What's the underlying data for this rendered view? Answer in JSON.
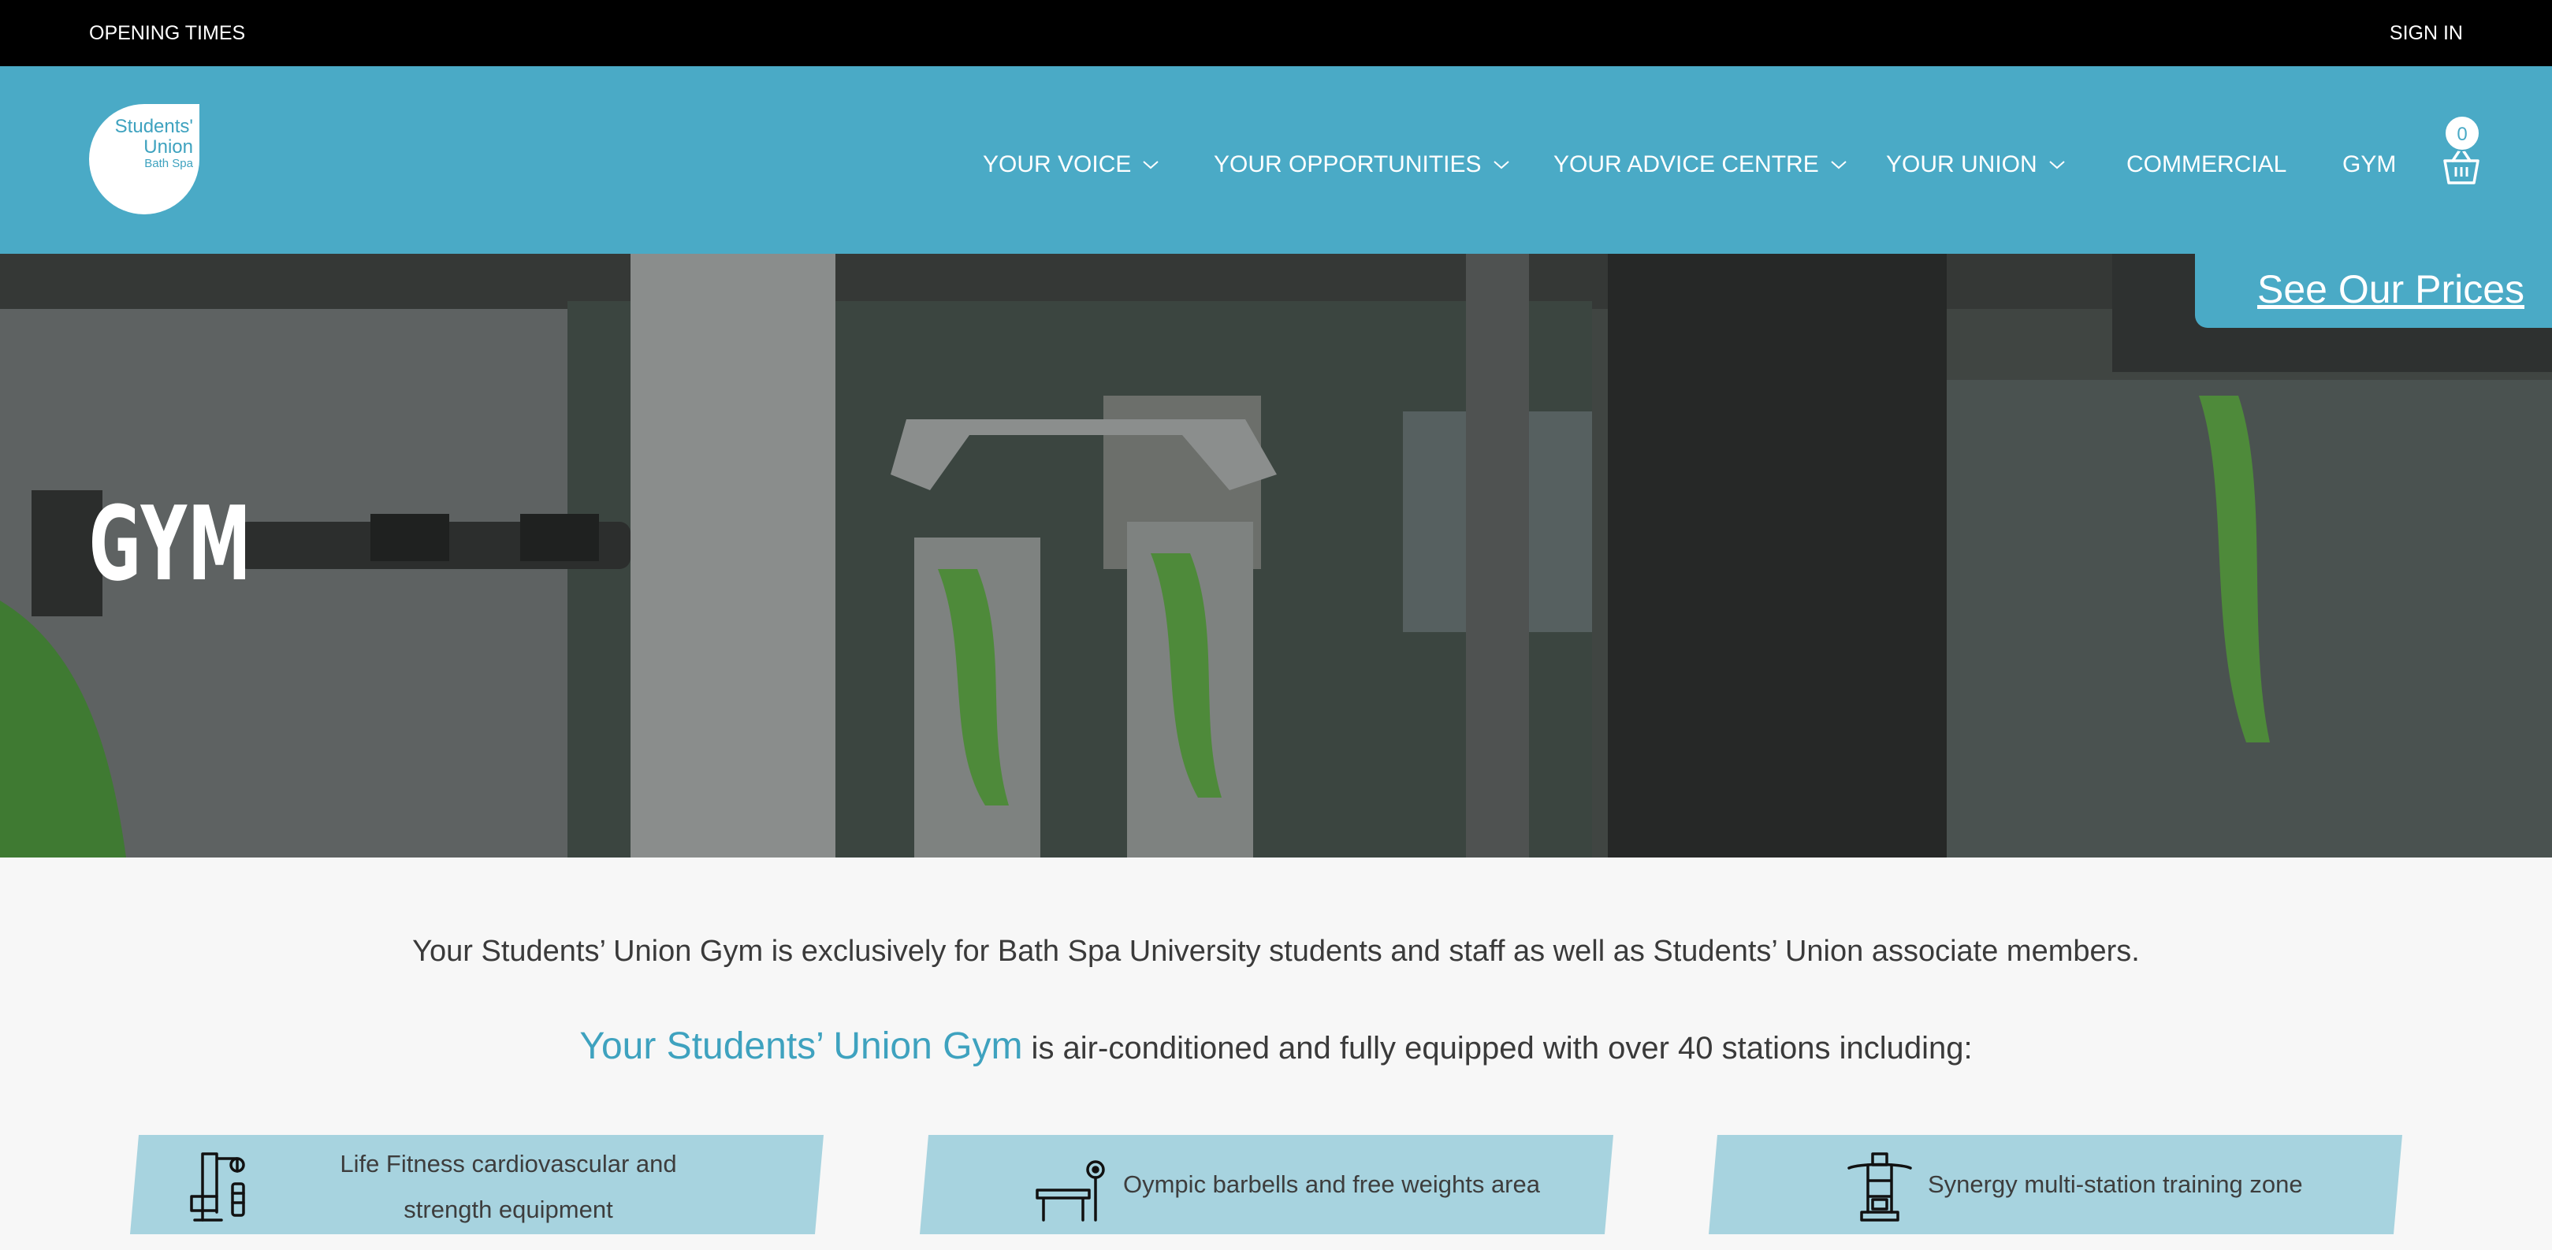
{
  "topbar": {
    "opening_times": "OPENING TIMES",
    "sign_in": "SIGN IN"
  },
  "logo": {
    "line1": "Students'",
    "line2": "Union",
    "line3": "Bath Spa"
  },
  "nav": [
    {
      "label": "YOUR VOICE",
      "dropdown": true
    },
    {
      "label": "YOUR OPPORTUNITIES",
      "dropdown": true
    },
    {
      "label": "YOUR ADVICE CENTRE",
      "dropdown": true
    },
    {
      "label": "YOUR UNION",
      "dropdown": true
    },
    {
      "label": "COMMERCIAL",
      "dropdown": false
    },
    {
      "label": "GYM",
      "dropdown": false
    }
  ],
  "cart": {
    "icon": "basket-icon",
    "count": "0"
  },
  "hero": {
    "title": "GYM",
    "see_prices": "See Our Prices"
  },
  "intro": {
    "p1": "Your Students’ Union Gym is exclusively for Bath Spa University students and staff as well as Students’ Union associate members.",
    "p2_highlight": "Your Students’ Union Gym",
    "p2_rest": " is air-conditioned and fully equipped with over 40 stations including:"
  },
  "features": [
    {
      "icon": "cable-machine-icon",
      "text": "Life Fitness cardiovascular and strength equipment"
    },
    {
      "icon": "barbell-bench-icon",
      "text": "Oympic barbells and free weights area"
    },
    {
      "icon": "multi-station-icon",
      "text": "Synergy multi-station training zone"
    }
  ],
  "colors": {
    "brand": "#4aaac6",
    "feature_bg": "#a7d3df",
    "topbar": "#000000",
    "highlight": "#3ea2bf"
  }
}
